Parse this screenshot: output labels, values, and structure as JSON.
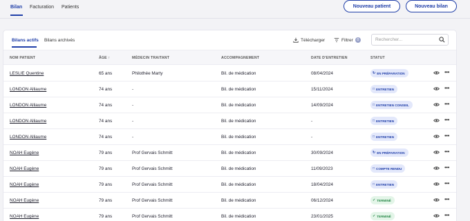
{
  "nav": {
    "tabs": [
      "Bilan",
      "Facturation",
      "Patients"
    ],
    "new_patient_label": "Nouveau patient",
    "new_bilan_label": "Nouveau bilan"
  },
  "toolbar": {
    "subtabs": [
      "Bilans actifs",
      "Bilans archivés"
    ],
    "download_label": "Télécharger",
    "filter_label": "Filtrer",
    "filter_count": "0",
    "search_placeholder": "Rechercher..."
  },
  "table": {
    "columns": {
      "name": "NOM PATIENT",
      "age": "ÂGE",
      "doctor": "MÉDECIN TRAITANT",
      "support": "ACCOMPAGNEMENT",
      "date": "DATE D'ENTRETIEN",
      "status": "STATUT"
    },
    "rows": [
      {
        "name": "LESLIE Quentine",
        "age": "65 ans",
        "doctor": "Philothée Marty",
        "support": "Bil. de médication",
        "date": "08/04/2024",
        "status": "EN PRÉPARATION",
        "status_kind": "preparation"
      },
      {
        "name": "LONDON Alliaume",
        "age": "74 ans",
        "doctor": "-",
        "support": "Bil. de médication",
        "date": "15/11/2024",
        "status": "ENTRETIEN",
        "status_kind": "entretien"
      },
      {
        "name": "LONDON Alliaume",
        "age": "74 ans",
        "doctor": "-",
        "support": "Bil. de médication",
        "date": "14/09/2024",
        "status": "ENTRETIEN CONSEIL",
        "status_kind": "entretien"
      },
      {
        "name": "LONDON Alliaume",
        "age": "74 ans",
        "doctor": "-",
        "support": "Bil. de médication",
        "date": "-",
        "status": "ENTRETIEN",
        "status_kind": "entretien"
      },
      {
        "name": "LONDON Alliaume",
        "age": "74 ans",
        "doctor": "-",
        "support": "Bil. de médication",
        "date": "-",
        "status": "ENTRETIEN",
        "status_kind": "entretien"
      },
      {
        "name": "NOAH Eugène",
        "age": "79 ans",
        "doctor": "Prof Gervais Schmitt",
        "support": "Bil. de médication",
        "date": "30/09/2024",
        "status": "EN PRÉPARATION",
        "status_kind": "preparation"
      },
      {
        "name": "NOAH Eugène",
        "age": "79 ans",
        "doctor": "Prof Gervais Schmitt",
        "support": "Bil. de médication",
        "date": "11/09/2023",
        "status": "COMPTE RENDU",
        "status_kind": "entretien"
      },
      {
        "name": "NOAH Eugène",
        "age": "79 ans",
        "doctor": "Prof Gervais Schmitt",
        "support": "Bil. de médication",
        "date": "18/04/2024",
        "status": "ENTRETIEN",
        "status_kind": "entretien"
      },
      {
        "name": "NOAH Eugène",
        "age": "79 ans",
        "doctor": "Prof Gervais Schmitt",
        "support": "Bil. de médication",
        "date": "06/12/2024",
        "status": "TERMINÉ",
        "status_kind": "done"
      },
      {
        "name": "NOAH Eugène",
        "age": "79 ans",
        "doctor": "Prof Gervais Schmitt",
        "support": "Bil. de médication",
        "date": "23/01/2025",
        "status": "TERMINÉ",
        "status_kind": "done"
      }
    ]
  },
  "colors": {
    "accent": "#1f3ea8",
    "status_blue_bg": "#e3e8fb",
    "status_green_bg": "#e3f5e8",
    "status_green_fg": "#2b8a4b"
  }
}
